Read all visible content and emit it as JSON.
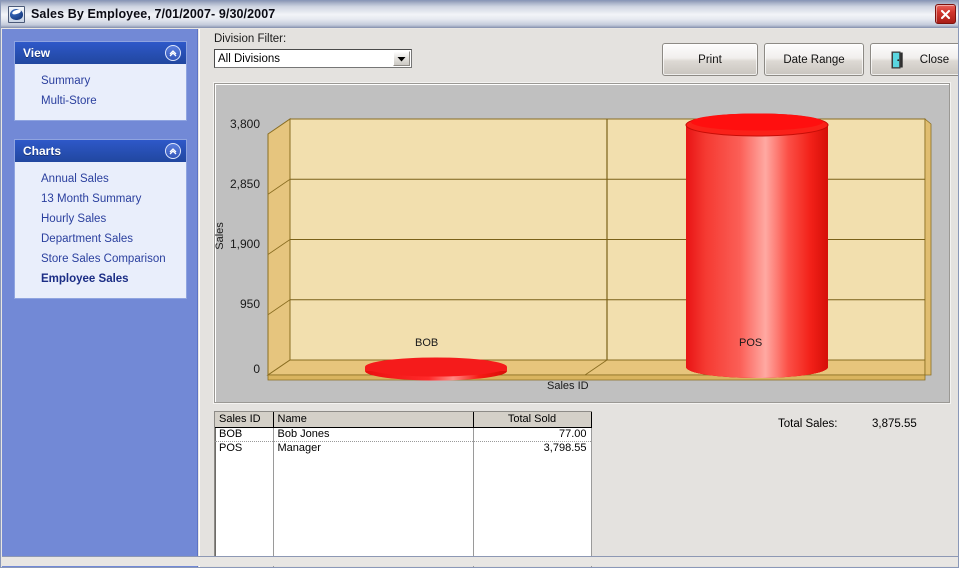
{
  "window": {
    "title": "Sales By Employee,  7/01/2007- 9/30/2007",
    "icon": "app-logo-icon",
    "close_icon": "close-icon"
  },
  "sidebar": {
    "panels": [
      {
        "title": "View",
        "collapse_icon": "chevron-up-icon",
        "items": [
          {
            "label": "Summary",
            "active": false
          },
          {
            "label": "Multi-Store",
            "active": false
          }
        ]
      },
      {
        "title": "Charts",
        "collapse_icon": "chevron-up-icon",
        "items": [
          {
            "label": "Annual Sales",
            "active": false
          },
          {
            "label": "13 Month Summary",
            "active": false
          },
          {
            "label": "Hourly Sales",
            "active": false
          },
          {
            "label": "Department Sales",
            "active": false
          },
          {
            "label": "Store Sales Comparison",
            "active": false
          },
          {
            "label": "Employee Sales",
            "active": true
          }
        ]
      }
    ]
  },
  "toolbar": {
    "filter_label": "Division Filter:",
    "division_value": "All Divisions",
    "division_options": [
      "All Divisions"
    ],
    "dropdown_icon": "chevron-down-icon",
    "print_label": "Print",
    "date_range_label": "Date Range",
    "close_label": "Close",
    "close_icon": "exit-door-icon"
  },
  "chart_data": {
    "type": "bar",
    "title": "",
    "xlabel": "Sales ID",
    "ylabel": "Sales",
    "categories": [
      "BOB",
      "POS"
    ],
    "values": [
      77.0,
      3798.55
    ],
    "ylim": [
      0,
      3800
    ],
    "yticks": [
      0,
      950,
      1900,
      2850,
      3800
    ],
    "ytick_labels": [
      "0",
      "950",
      "1,900",
      "2,850",
      "3,800"
    ],
    "grid": true,
    "legend": "none",
    "style": "3d-cylinder",
    "series_color": "#f51b1b",
    "wall_color": "#f2dfae",
    "floor_color": "#e7c57c",
    "plot_background": "#c0c0c0"
  },
  "table": {
    "columns": [
      "Sales ID",
      "Name",
      "Total Sold"
    ],
    "rows": [
      {
        "sales_id": "BOB",
        "name": "Bob Jones",
        "total_sold": "77.00"
      },
      {
        "sales_id": "POS",
        "name": "Manager",
        "total_sold": "3,798.55"
      }
    ]
  },
  "summary": {
    "total_sales_label": "Total Sales:",
    "total_sales_value": "3,875.55"
  }
}
